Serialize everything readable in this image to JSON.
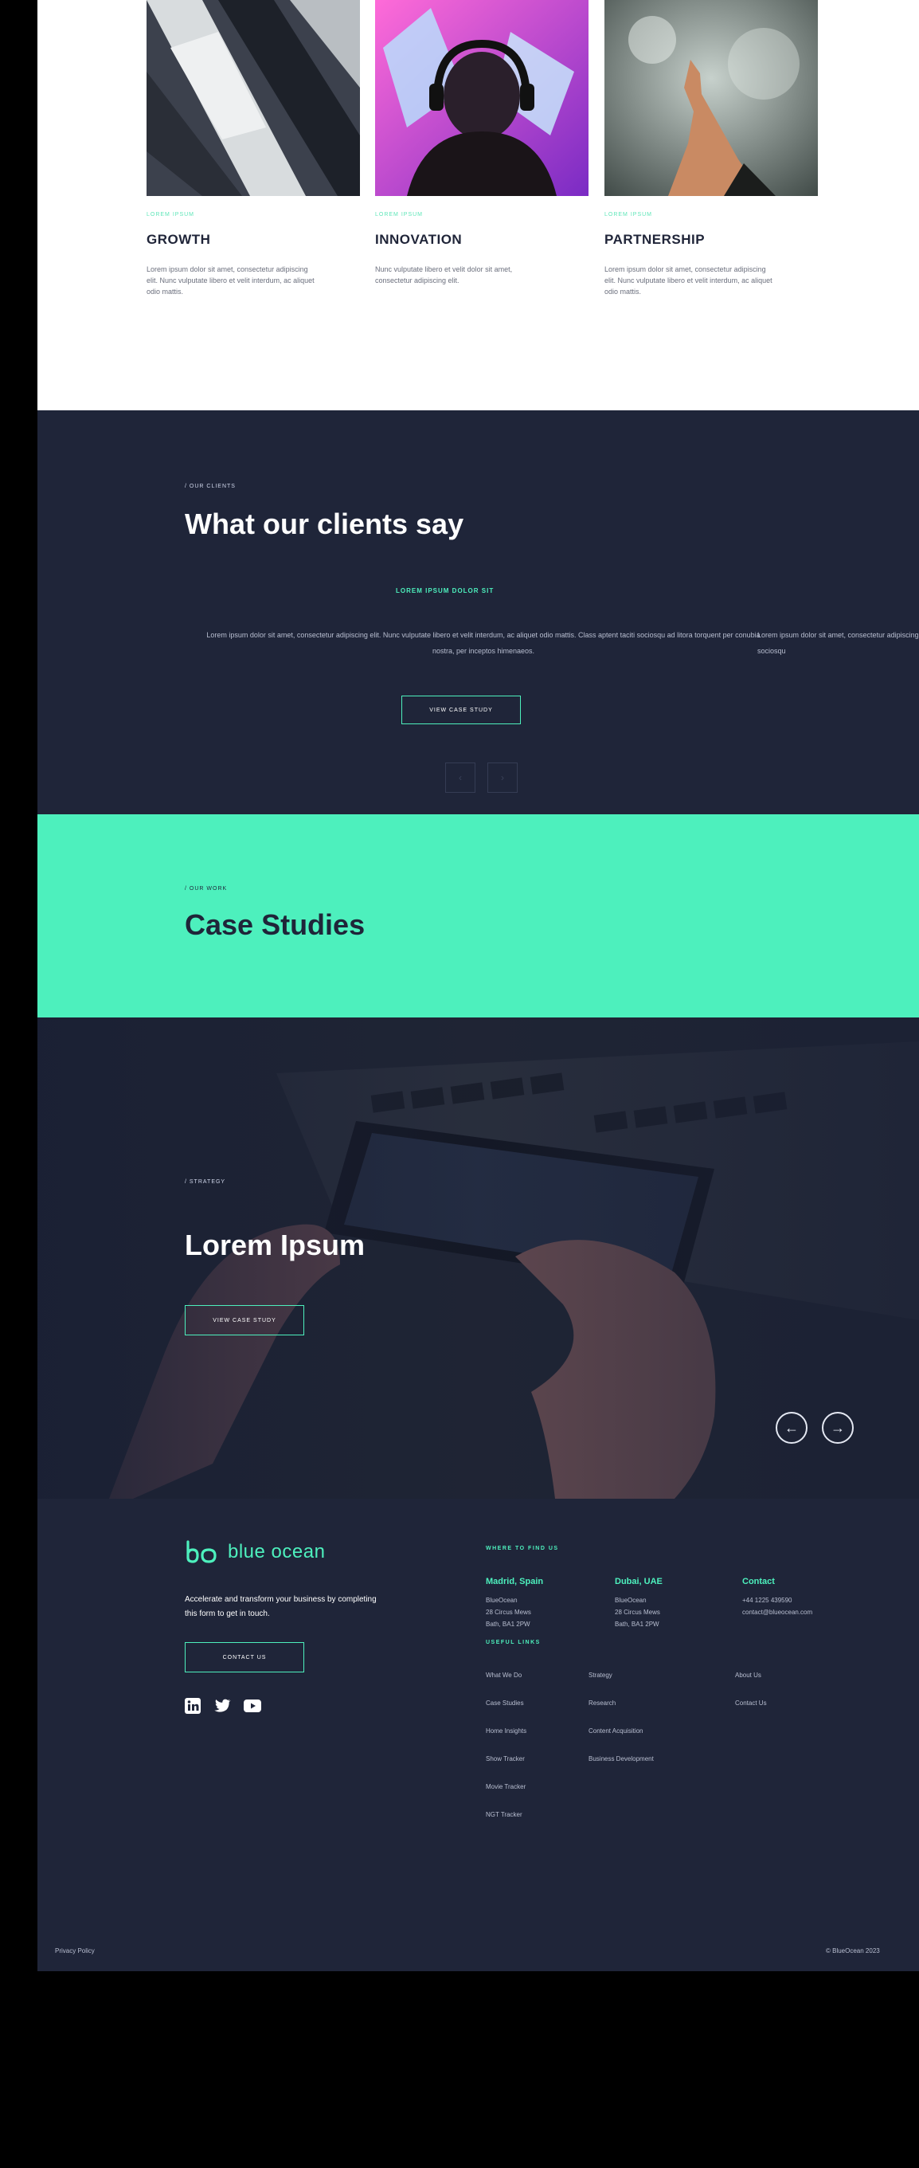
{
  "values": {
    "cards": [
      {
        "kicker": "Lorem ipsum",
        "title": "GROWTH",
        "text": "Lorem ipsum dolor sit amet, consectetur adipiscing elit. Nunc vulputate libero et velit interdum, ac aliquet odio mattis."
      },
      {
        "kicker": "Lorem ipsum",
        "title": "INNOVATION",
        "text": "Nunc vulputate libero et velit dolor sit amet, consectetur adipiscing elit."
      },
      {
        "kicker": "Lorem ipsum",
        "title": "PARTNERSHIP",
        "text": "Lorem ipsum dolor sit amet, consectetur adipiscing elit. Nunc vulputate libero et velit interdum, ac aliquet odio mattis."
      }
    ]
  },
  "clients": {
    "kicker": "/ our clients",
    "title": "What our clients say",
    "quote_head": "LOREM IPSUM DOLOR SIT",
    "quote": "Lorem ipsum dolor sit amet, consectetur adipiscing elit. Nunc vulputate libero et velit interdum, ac aliquet odio mattis. Class aptent taciti sociosqu ad litora torquent per conubia nostra, per inceptos himenaeos.",
    "quote_next": "Lorem ipsum dolor sit amet, consectetur adipiscing elit. Nunc vulputate mattis. Class aptent taciti sociosqu",
    "button": "View case study",
    "prev_icon": "‹",
    "next_icon": "›"
  },
  "cases": {
    "kicker": "/ our work",
    "title": "Case Studies"
  },
  "hero": {
    "kicker": "/ strategy",
    "title": "Lorem Ipsum",
    "button": "View case study",
    "prev_icon": "←",
    "next_icon": "→"
  },
  "footer": {
    "logo_text": "blue ocean",
    "tagline": "Accelerate and transform your business by completing this form to get in touch.",
    "contact_button": "Contact us",
    "find_us_head": "Where to find us",
    "locations": [
      {
        "title": "Madrid, Spain",
        "lines": [
          "BlueOcean",
          "28 Circus Mews",
          "Bath, BA1 2PW"
        ]
      },
      {
        "title": "Dubai, UAE",
        "lines": [
          "BlueOcean",
          "28 Circus Mews",
          "Bath, BA1 2PW"
        ]
      },
      {
        "title": "Contact",
        "lines": [
          "+44 1225 439590",
          "contact@blueocean.com"
        ]
      }
    ],
    "links_head": "Useful links",
    "links_col1": [
      "What We Do",
      "Case Studies",
      "Home Insights",
      "Show Tracker",
      "Movie Tracker",
      "NGT Tracker"
    ],
    "links_col2": [
      "Strategy",
      "Research",
      "Content Acquisition",
      "Business Development"
    ],
    "links_col3": [
      "About Us",
      "Contact Us"
    ],
    "privacy": "Privacy Policy",
    "copyright": "© BlueOcean 2023"
  }
}
